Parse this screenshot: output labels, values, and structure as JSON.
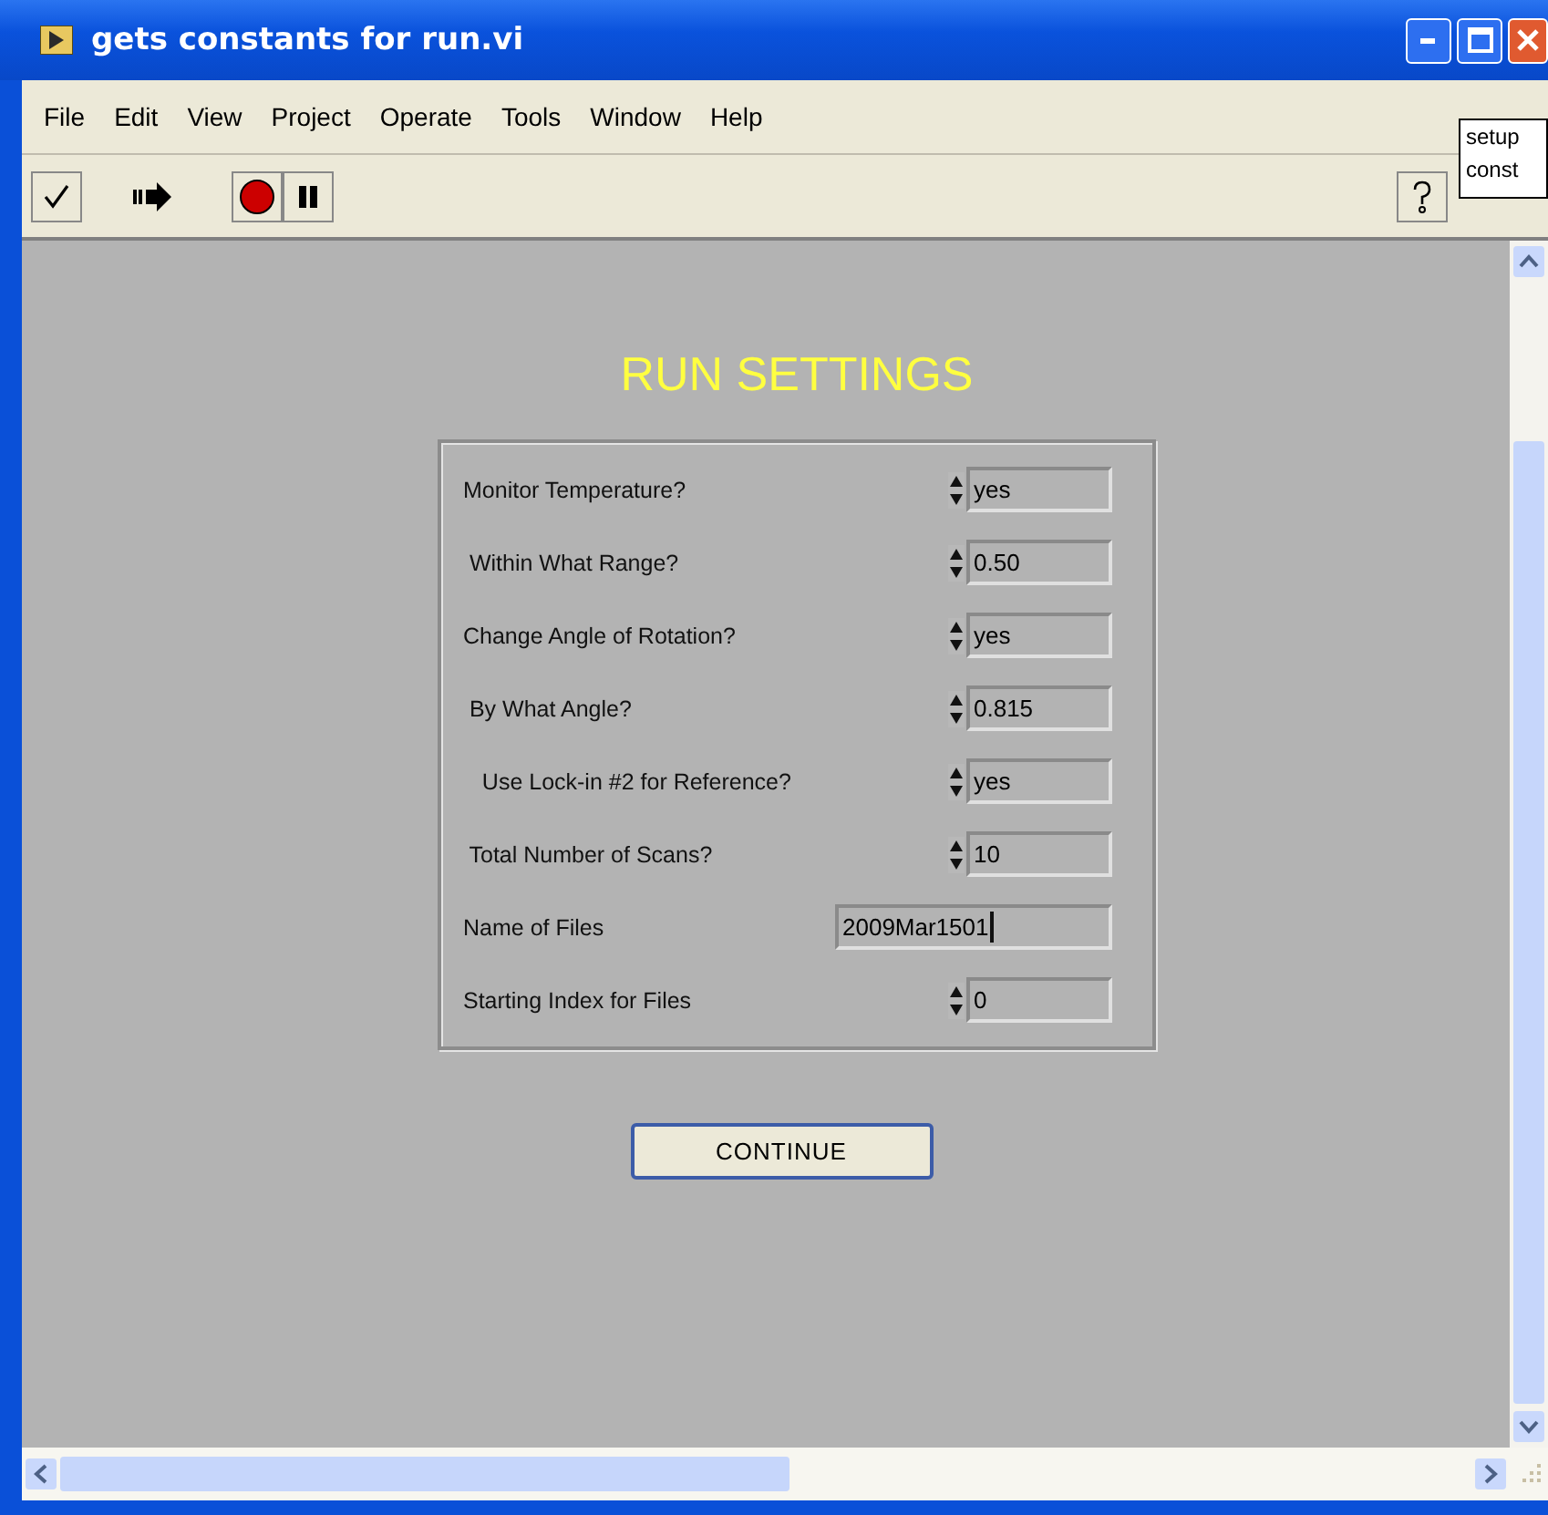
{
  "window": {
    "title": "gets constants for run.vi"
  },
  "menu": [
    "File",
    "Edit",
    "View",
    "Project",
    "Operate",
    "Tools",
    "Window",
    "Help"
  ],
  "context_help_label": "setup const",
  "panel": {
    "title": "RUN SETTINGS",
    "rows": [
      {
        "kind": "ring",
        "label": "Monitor Temperature?",
        "value": "yes"
      },
      {
        "kind": "numeric",
        "label": " Within What Range?",
        "value": "0.50"
      },
      {
        "kind": "ring",
        "label": "Change Angle of Rotation?",
        "value": "yes"
      },
      {
        "kind": "numeric",
        "label": " By What Angle?",
        "value": "0.815"
      },
      {
        "kind": "ring",
        "label": "   Use Lock-in #2 for Reference?",
        "value": "yes"
      },
      {
        "kind": "numeric",
        "label": " Total Number of Scans?",
        "value": "10"
      },
      {
        "kind": "string",
        "label": "Name of Files",
        "value": "2009Mar1501"
      },
      {
        "kind": "numeric",
        "label": "Starting Index for Files",
        "value": "0"
      }
    ]
  },
  "continue_button": "CONTINUE"
}
